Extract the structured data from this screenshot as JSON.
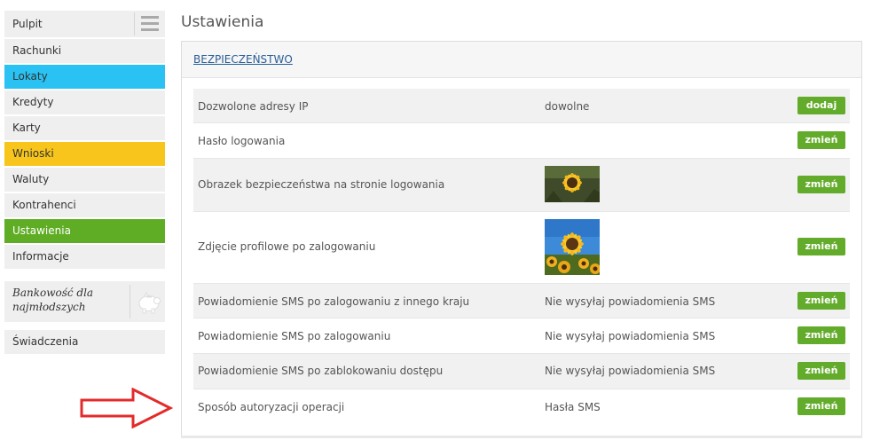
{
  "sidebar": {
    "top_label": "Pulpit",
    "items": [
      {
        "label": "Rachunki"
      },
      {
        "label": "Lokaty",
        "color": "#29c2f2"
      },
      {
        "label": "Kredyty"
      },
      {
        "label": "Karty"
      },
      {
        "label": "Wnioski",
        "color": "#f7c51b"
      },
      {
        "label": "Waluty"
      },
      {
        "label": "Kontrahenci"
      },
      {
        "label": "Ustawienia",
        "color": "#5fad24",
        "active": true
      },
      {
        "label": "Informacje"
      }
    ],
    "promo_text": "Bankowość dla najmłodszych",
    "promo_icon": "piggy-bank-icon",
    "extra_item": "Świadczenia"
  },
  "page": {
    "title": "Ustawienia",
    "section_link": "BEZPIECZEŃSTWO"
  },
  "settings": [
    {
      "name": "Dozwolone adresy IP",
      "value": "dowolne",
      "button": "dodaj"
    },
    {
      "name": "Hasło logowania",
      "value": "",
      "button": "zmień"
    },
    {
      "name": "Obrazek bezpieczeństwa na stronie logowania",
      "value": "",
      "image": "sunflower-photo",
      "button": "zmień"
    },
    {
      "name": "Zdjęcie profilowe po zalogowaniu",
      "value": "",
      "image": "sunflower-field-photo",
      "button": "zmień"
    },
    {
      "name": "Powiadomienie SMS po zalogowaniu z innego kraju",
      "value": "Nie wysyłaj powiadomienia SMS",
      "button": "zmień"
    },
    {
      "name": "Powiadomienie SMS po zalogowaniu",
      "value": "Nie wysyłaj powiadomienia SMS",
      "button": "zmień"
    },
    {
      "name": "Powiadomienie SMS po zablokowaniu dostępu",
      "value": "Nie wysyłaj powiadomienia SMS",
      "button": "zmień"
    },
    {
      "name": "Sposób autoryzacji operacji",
      "value": "Hasła SMS",
      "button": "zmień"
    }
  ],
  "colors": {
    "accent_green": "#63ab2a",
    "link_blue": "#2a5e98",
    "arrow_red": "#e32b2b"
  }
}
